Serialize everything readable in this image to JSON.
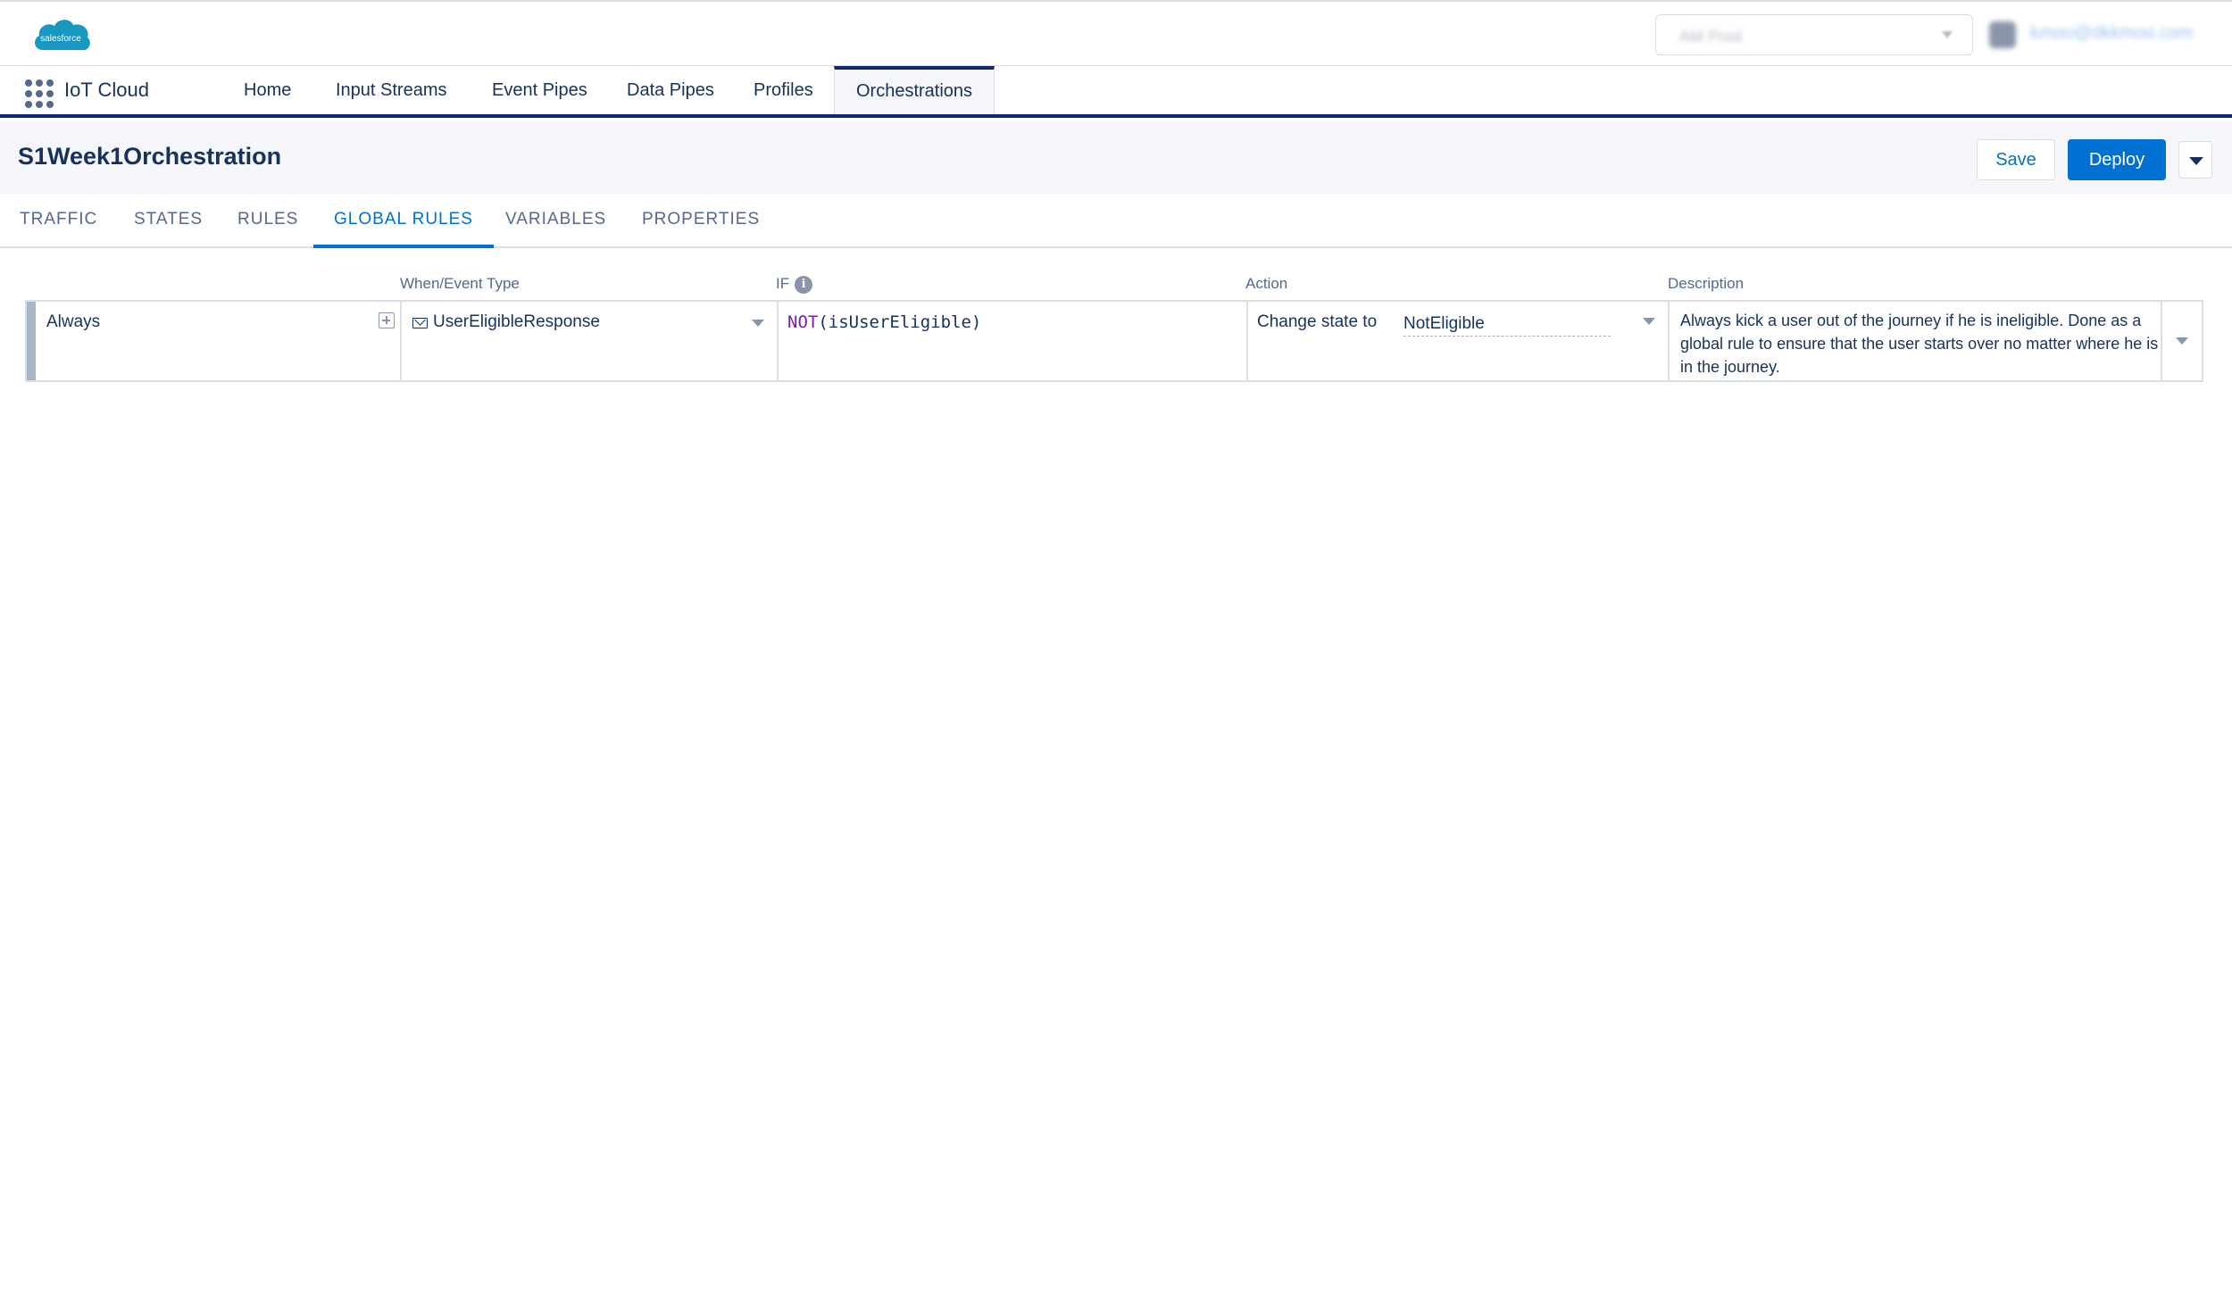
{
  "colors": {
    "brand_blue": "#0070d2",
    "nav_underline": "#0b2a70",
    "text_primary": "#16325c",
    "text_secondary": "#54698d",
    "border": "#d8dde6",
    "salesforce_cloud": "#1798c1"
  },
  "global_header": {
    "logo_text": "salesforce",
    "org_select_value": "AM Prod",
    "user_email": "kmoo@dkkmoo.com"
  },
  "app_nav": {
    "app_name": "IoT Cloud",
    "items": [
      {
        "label": "Home"
      },
      {
        "label": "Input Streams"
      },
      {
        "label": "Event Pipes"
      },
      {
        "label": "Data Pipes"
      },
      {
        "label": "Profiles"
      },
      {
        "label": "Orchestrations"
      }
    ],
    "active_item": "Orchestrations"
  },
  "page_header": {
    "title": "S1Week1Orchestration",
    "save_label": "Save",
    "deploy_label": "Deploy"
  },
  "tabs": {
    "items": [
      {
        "label": "TRAFFIC"
      },
      {
        "label": "STATES"
      },
      {
        "label": "RULES"
      },
      {
        "label": "GLOBAL RULES"
      },
      {
        "label": "VARIABLES"
      },
      {
        "label": "PROPERTIES"
      }
    ],
    "active_tab": "GLOBAL RULES"
  },
  "rules_table": {
    "columns": {
      "when_event_type": "When/Event Type",
      "if": "IF",
      "action": "Action",
      "description": "Description"
    },
    "rows": [
      {
        "scope": "Always",
        "event_type": "UserEligibleResponse",
        "condition_fn": "NOT",
        "condition_arg": "(isUserEligible)",
        "action_prefix": "Change state to",
        "action_state": "NotEligible",
        "description": "Always kick a user out of the journey if he is ineligible. Done as a global rule to ensure that the user starts over no matter where he is in the journey."
      }
    ]
  }
}
